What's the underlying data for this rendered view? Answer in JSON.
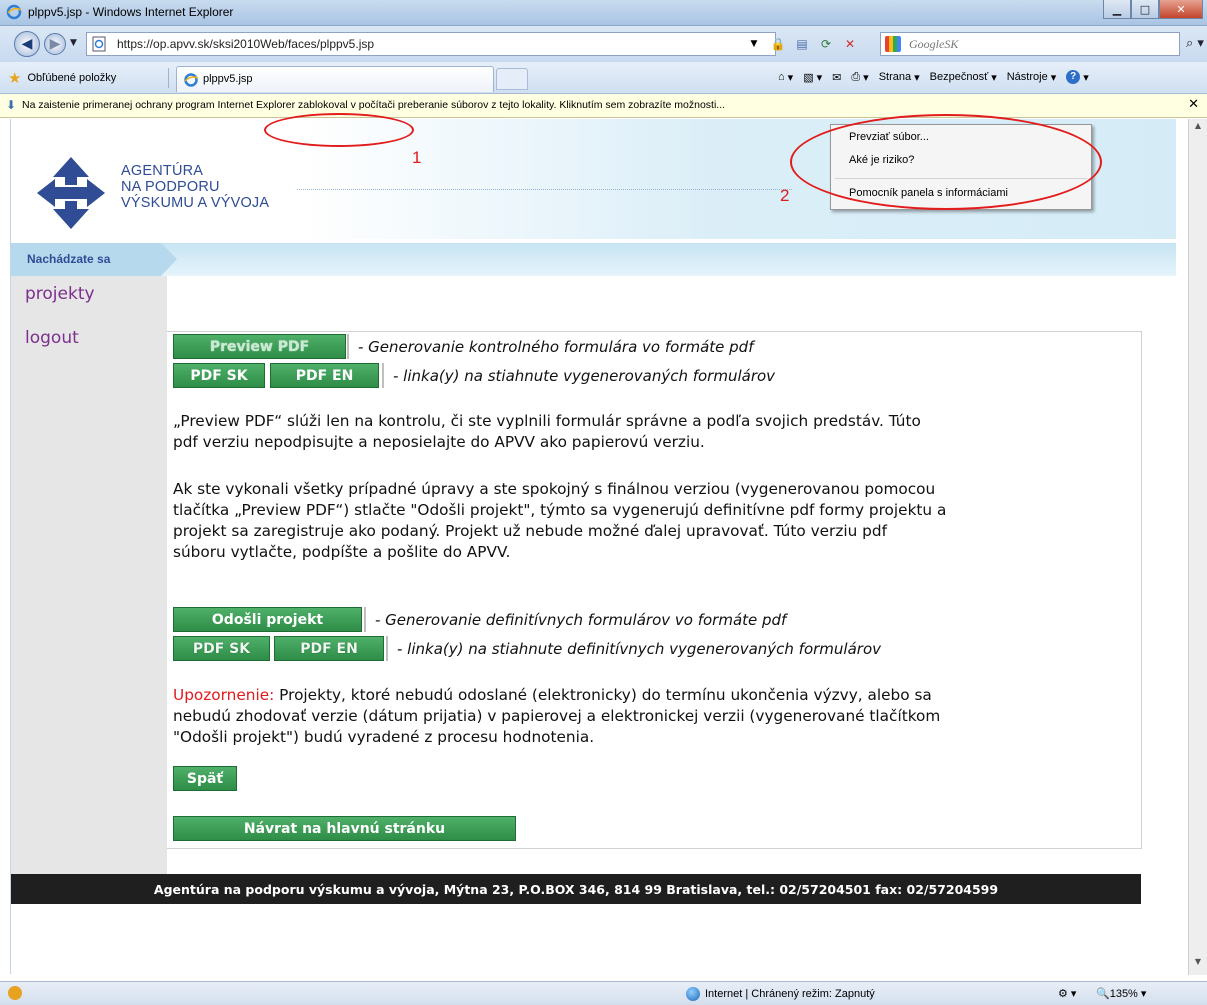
{
  "window": {
    "title": "plppv5.jsp - Windows Internet Explorer"
  },
  "address_bar": {
    "url": "https://op.apvv.sk/sksi2010Web/faces/plppv5.jsp",
    "search_placeholder": "GoogleSK"
  },
  "toolbar": {
    "favorites_label": "Obľúbené položky",
    "tab_label": "plppv5.jsp",
    "page_menu": "Strana",
    "safety_menu": "Bezpečnosť",
    "tools_menu": "Nástroje"
  },
  "infobar": {
    "text": "Na zaistenie primeranej ochrany program Internet Explorer zablokoval v počítači preberanie súborov z tejto lokality. Kliknutím sem zobrazíte možnosti..."
  },
  "context_menu": {
    "items": [
      "Prevziať súbor...",
      "Aké je riziko?",
      "Pomocník panela s informáciami"
    ]
  },
  "annotations": {
    "label1": "1",
    "label2": "2"
  },
  "header": {
    "logo_line1": "AGENTÚRA",
    "logo_line2": "NA PODPORU",
    "logo_line3": "VÝSKUMU A VÝVOJA",
    "breadcrumb": "Nachádzate sa"
  },
  "sidebar": {
    "links": [
      "projekty",
      "logout"
    ]
  },
  "main": {
    "preview_button": "Preview PDF",
    "preview_desc": "- Generovanie kontrolného formulára vo formáte pdf",
    "pdf_sk": "PDF SK",
    "pdf_en": "PDF EN",
    "links_desc": "- linka(y) na stiahnute vygenerovaných formulárov",
    "para1_line1": "„Preview PDF“ slúži len na kontrolu, či ste vyplnili formulár správne a podľa svojich predstáv. Túto",
    "para1_line2": "pdf verziu nepodpisujte a neposielajte do APVV ako papierovú verziu.",
    "para2_line1": "Ak ste vykonali všetky prípadné úpravy a ste spokojný s finálnou verziou (vygenerovanou pomocou",
    "para2_line2": "tlačítka „Preview PDF“) stlačte \"Odošli projekt\", týmto sa vygenerujú definitívne pdf formy projektu a",
    "para2_line3": "projekt sa zaregistruje ako podaný. Projekt už nebude možné ďalej upravovať. Túto verziu pdf",
    "para2_line4": "súboru vytlačte, podpíšte a pošlite do APVV.",
    "submit_button": "Odošli projekt",
    "submit_desc": "- Generovanie definitívnych formulárov vo formáte pdf",
    "final_links_desc": "- linka(y) na stiahnute definitívnych vygenerovaných formulárov",
    "warning_label": "Upozornenie:",
    "warning_line1": " Projekty, ktoré nebudú odoslané (elektronicky) do termínu ukončenia výzvy, alebo sa",
    "warning_line2": "nebudú zhodovať verzie (dátum prijatia) v papierovej a elektronickej verzii (vygenerované tlačítkom",
    "warning_line3": "\"Odošli projekt\") budú vyradené z procesu hodnotenia.",
    "back_button": "Späť",
    "home_button": "Návrat na hlavnú stránku"
  },
  "footer": {
    "text": "Agentúra na podporu výskumu a vývoja, Mýtna 23, P.O.BOX 346, 814 99 Bratislava, tel.: 02/57204501 fax: 02/57204599"
  },
  "statusbar": {
    "zone": "Internet | Chránený režim: Zapnutý",
    "zoom": "135%"
  }
}
